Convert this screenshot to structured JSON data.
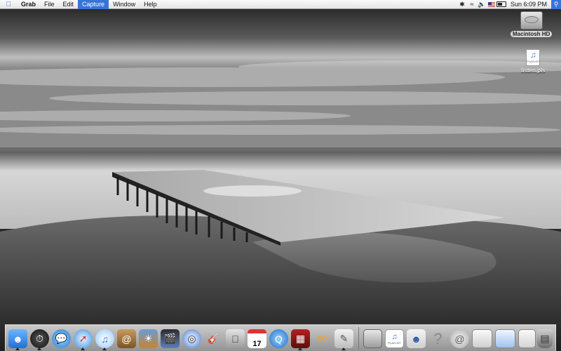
{
  "menubar": {
    "app_name": "Grab",
    "menus": [
      "File",
      "Edit",
      "Capture",
      "Window",
      "Help"
    ],
    "active_menu": "Capture",
    "clock": "Sun 6:09 PM"
  },
  "desktop": {
    "icons": [
      {
        "label": "Macintosh HD"
      },
      {
        "label": "listen.pls",
        "badge": "PLAYLIST"
      }
    ]
  },
  "dock": {
    "items": [
      "Finder",
      "Dashboard",
      "iChat",
      "Safari",
      "iTunes",
      "Address Book",
      "iPhoto",
      "iMovie",
      "iDVD",
      "GarageBand",
      "System Preferences",
      "iCal",
      "QuickTime Player",
      "Grab",
      "Mail",
      "Preview",
      "Macintosh HD",
      "listen.pls",
      "Photo",
      "Help",
      "Mail Drop",
      "Window 1",
      "Window 2",
      "Window 3",
      "Trash"
    ],
    "calendar_day": "17",
    "playlist_tag": "PLAYLIST"
  }
}
